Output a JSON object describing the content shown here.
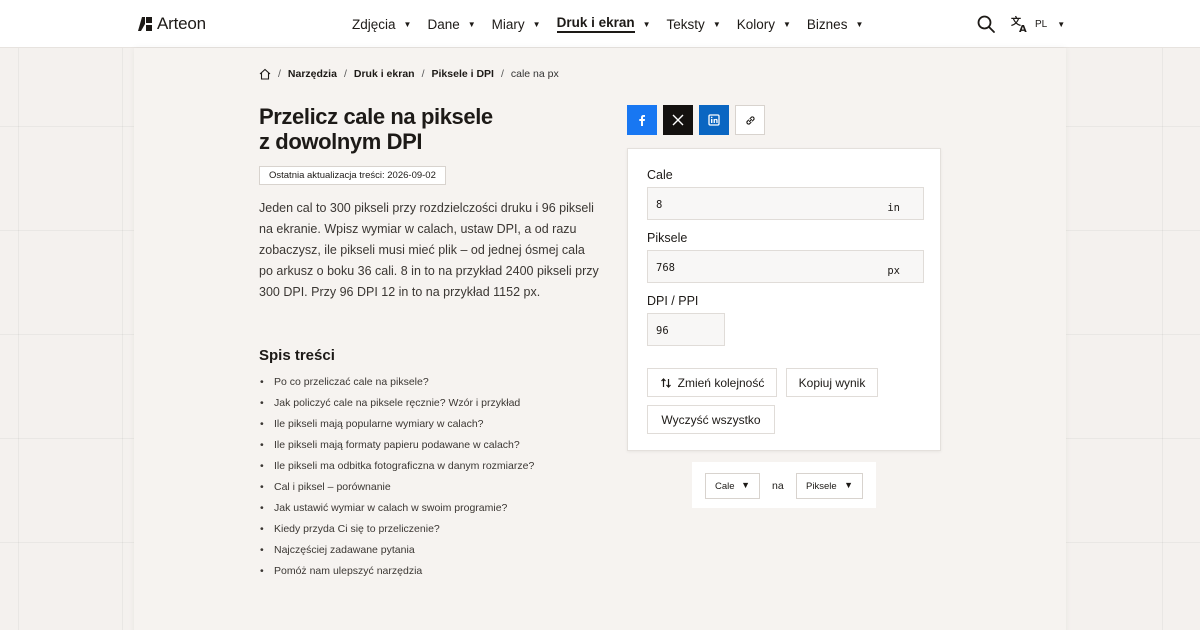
{
  "brand": {
    "name": "Arteon"
  },
  "nav": {
    "items": [
      {
        "label": "Zdjęcia"
      },
      {
        "label": "Dane"
      },
      {
        "label": "Miary"
      },
      {
        "label": "Druk i ekran",
        "active": true
      },
      {
        "label": "Teksty"
      },
      {
        "label": "Kolory"
      },
      {
        "label": "Biznes"
      }
    ],
    "lang": "PL"
  },
  "breadcrumb": {
    "items": [
      "Narzędzia",
      "Druk i ekran",
      "Piksele i DPI"
    ],
    "current": "cale na px"
  },
  "page": {
    "title_line1": "Przelicz cale na piksele",
    "title_line2": "z dowolnym DPI",
    "updated": "Ostatnia aktualizacja treści: 2026-09-02",
    "intro": "Jeden cal to 300 pikseli przy rozdzielczości druku i 96 pikseli na ekranie. Wpisz wymiar w calach, ustaw DPI, a od razu zobaczysz, ile pikseli musi mieć plik – od jednej ósmej cala po arkusz o boku 36 cali. 8 in to na przykład 2400 pikseli przy 300 DPI. Przy 96 DPI 12 in to na przykład 1152 px."
  },
  "toc": {
    "title": "Spis treści",
    "items": [
      "Po co przeliczać cale na piksele?",
      "Jak policzyć cale na piksele ręcznie? Wzór i przykład",
      "Ile pikseli mają popularne wymiary w calach?",
      "Ile pikseli mają formaty papieru podawane w calach?",
      "Ile pikseli ma odbitka fotograficzna w danym rozmiarze?",
      "Cal i piksel – porównanie",
      "Jak ustawić wymiar w calach w swoim programie?",
      "Kiedy przyda Ci się to przeliczenie?",
      "Najczęściej zadawane pytania",
      "Pomóż nam ulepszyć narzędzia"
    ]
  },
  "share": {
    "facebook_color": "#1877f2",
    "x_color": "#14110f",
    "linkedin_color": "#0a66c2"
  },
  "converter": {
    "inches": {
      "label": "Cale",
      "value": "8",
      "unit": "in"
    },
    "pixels": {
      "label": "Piksele",
      "value": "768",
      "unit": "px"
    },
    "dpi": {
      "label": "DPI / PPI",
      "value": "96"
    },
    "swap_label": "Zmień kolejność",
    "copy_label": "Kopiuj wynik",
    "clear_label": "Wyczyść wszystko"
  },
  "unit_selector": {
    "from": "Cale",
    "connector": "na",
    "to": "Piksele"
  }
}
